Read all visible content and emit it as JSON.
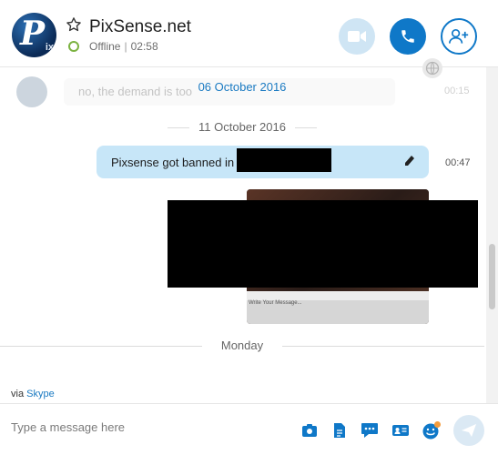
{
  "header": {
    "avatar_text": "P",
    "avatar_sub": "ix",
    "contact_name": "PixSense.net",
    "presence": "Offline",
    "local_time": "02:58",
    "separator": "|"
  },
  "history": {
    "faded_message": "no, the demand is too",
    "faded_time": "00:15",
    "date_overlay": "06 October 2016"
  },
  "messages": {
    "date_label": "11 October 2016",
    "outgoing_text": "Pixsense got banned in",
    "outgoing_time": "00:47",
    "image_hint": "Write Your Message..."
  },
  "day_divider": "Monday",
  "footer": {
    "via_prefix": "via",
    "via_link": "Skype",
    "input_placeholder": "Type a message here"
  },
  "colors": {
    "accent": "#0f78c8",
    "bubble": "#c7e6f8",
    "presence_ring": "#7cb342"
  },
  "icons": [
    "star-icon",
    "video-icon",
    "call-icon",
    "add-contact-icon",
    "globe-icon",
    "edit-icon",
    "photo-icon",
    "file-icon",
    "chat-icon",
    "contact-card-icon",
    "emoji-icon",
    "send-icon"
  ]
}
